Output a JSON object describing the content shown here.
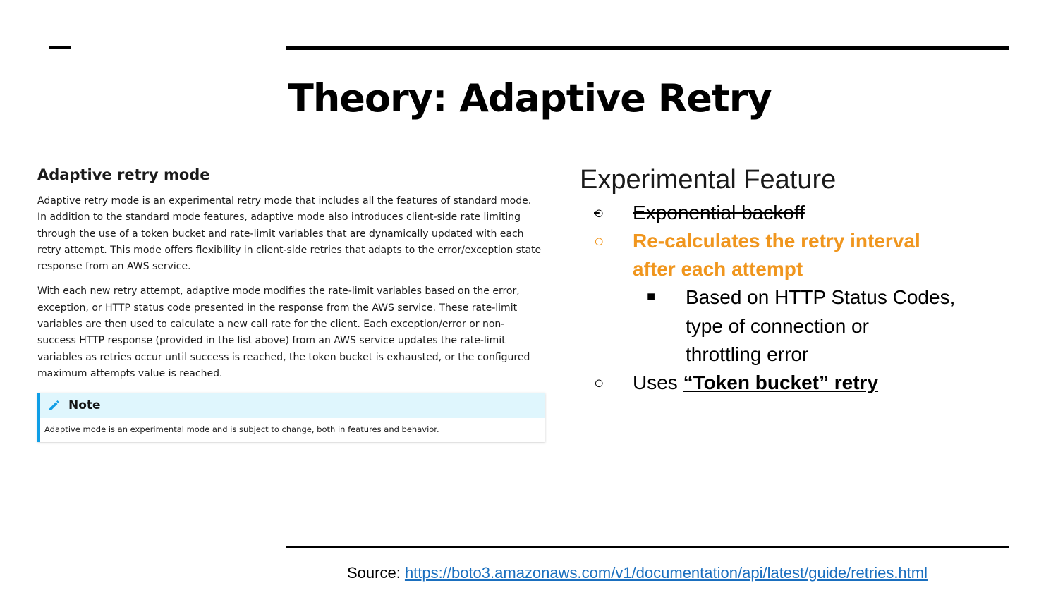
{
  "slide": {
    "title": "Theory: Adaptive Retry"
  },
  "doc": {
    "heading": "Adaptive retry mode",
    "para1": "Adaptive retry mode is an experimental retry mode that includes all the features of standard mode. In addition to the standard mode features, adaptive mode also introduces client-side rate limiting through the use of a token bucket and rate-limit variables that are dynamically updated with each retry attempt. This mode offers flexibility in client-side retries that adapts to the error/exception state response from an AWS service.",
    "para2": "With each new retry attempt, adaptive mode modifies the rate-limit variables based on the error, exception, or HTTP status code presented in the response from the AWS service. These rate-limit variables are then used to calculate a new call rate for the client. Each exception/error or non-success HTTP response (provided in the list above) from an AWS service updates the rate-limit variables as retries occur until success is reached, the token bucket is exhausted, or the configured maximum attempts value is reached.",
    "note_title": "Note",
    "note_icon": "pencil-icon",
    "note_text": "Adaptive mode is an experimental mode and is subject to change, both in features and behavior."
  },
  "bullets": {
    "heading": "Experimental Feature",
    "item1": "Exponential backoff",
    "item2_line1": "Re-calculates the retry interval",
    "item2_line2": "after each attempt",
    "sub_line1": "Based on HTTP Status Codes,",
    "sub_line2": "type of connection or",
    "sub_line3": "throttling error",
    "item3_prefix": "Uses ",
    "item3_link": "“Token bucket” retry",
    "bullet_hollow": "○",
    "bullet_square": "■"
  },
  "source": {
    "label": "Source: ",
    "url": "https://boto3.amazonaws.com/v1/documentation/api/latest/guide/retries.html"
  },
  "colors": {
    "accent_orange": "#f0961e",
    "note_border": "#0f9ee6",
    "note_bg": "#dff6fd",
    "link_blue": "#1a6fbf"
  }
}
